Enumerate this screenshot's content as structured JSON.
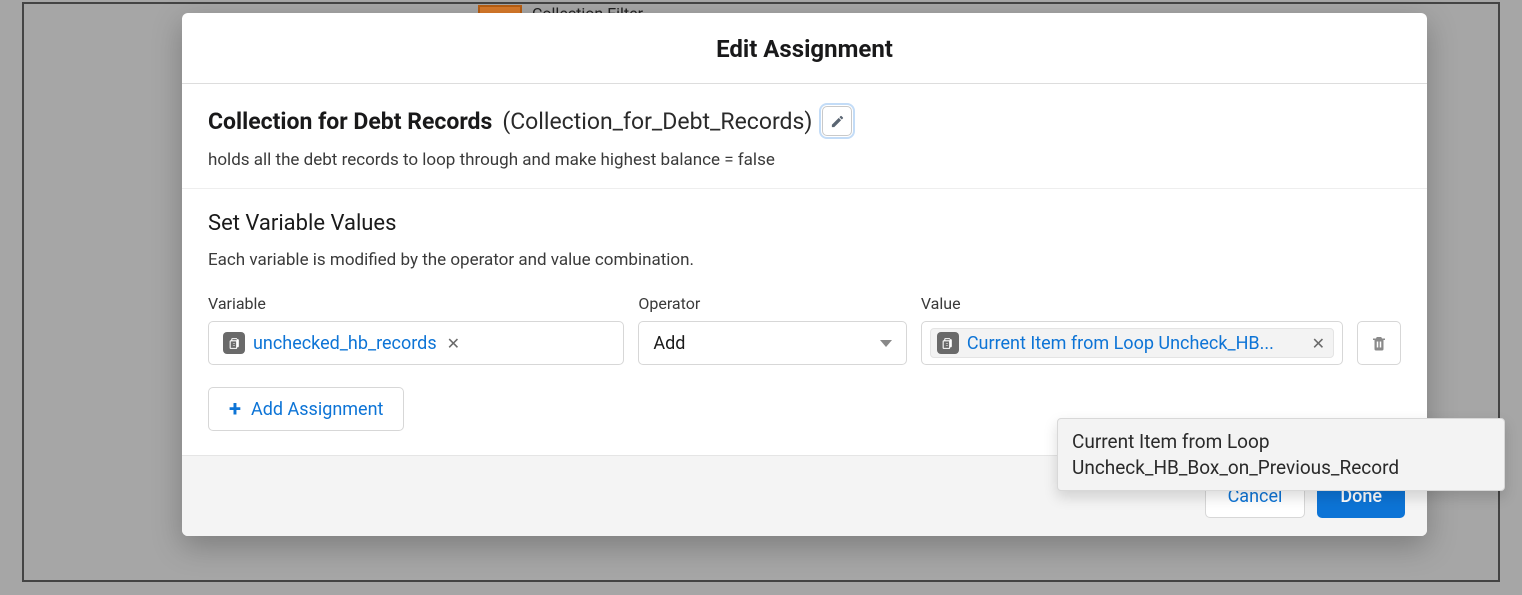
{
  "background": {
    "node_label": "Collection Filter"
  },
  "modal": {
    "title": "Edit Assignment",
    "record_name": "Collection for Debt Records",
    "api_name": "(Collection_for_Debt_Records)",
    "description": "holds all the debt records to loop through and make highest balance = false",
    "section_heading": "Set Variable Values",
    "section_sub": "Each variable is modified by the operator and value combination.",
    "columns": {
      "variable": "Variable",
      "operator": "Operator",
      "value": "Value"
    },
    "rows": [
      {
        "variable": "unchecked_hb_records",
        "operator": "Add",
        "value": "Current Item from Loop Uncheck_HB..."
      }
    ],
    "add_button": "Add Assignment",
    "footer": {
      "cancel": "Cancel",
      "done": "Done"
    }
  },
  "tooltip": "Current Item from Loop Uncheck_HB_Box_on_Previous_Record"
}
